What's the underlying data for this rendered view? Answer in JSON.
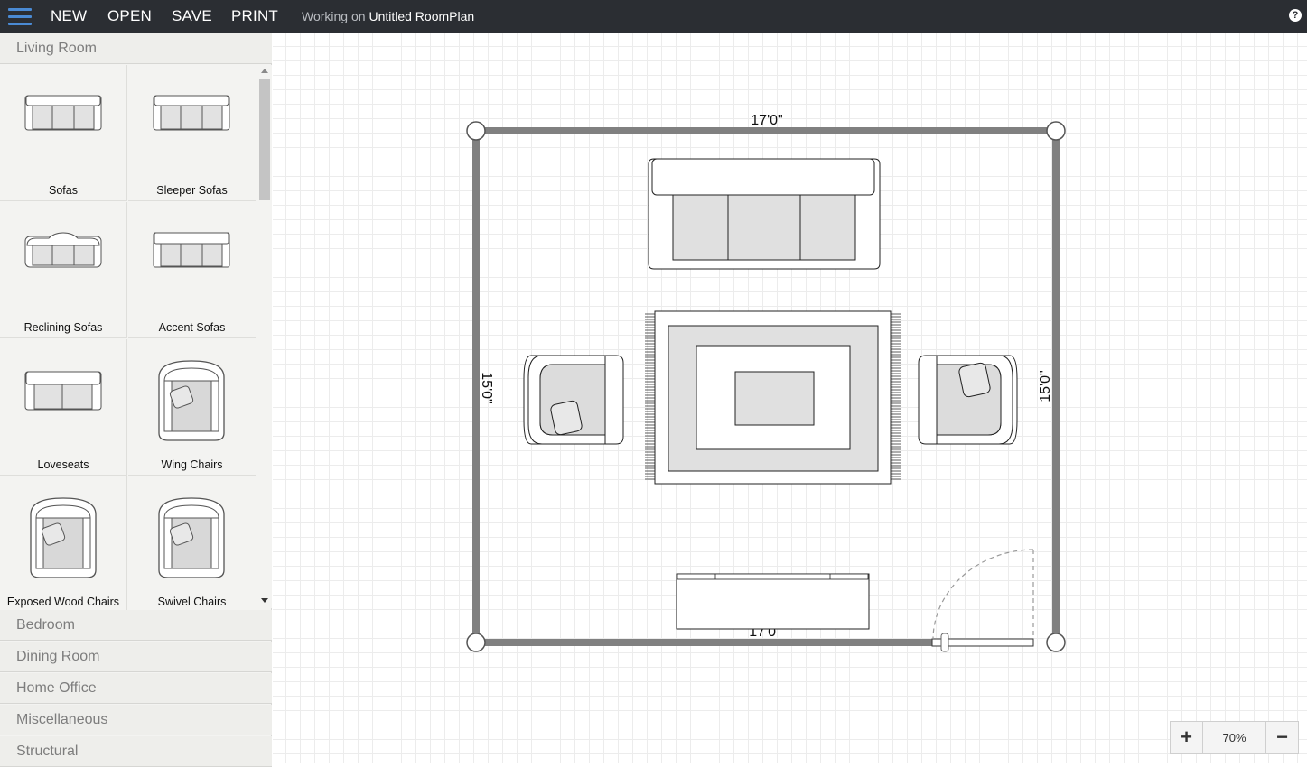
{
  "toolbar": {
    "new_label": "NEW",
    "open_label": "OPEN",
    "save_label": "SAVE",
    "print_label": "PRINT",
    "working_prefix": "Working on",
    "document_name": "Untitled RoomPlan",
    "help_label": "?"
  },
  "sidebar": {
    "active_category": "Living Room",
    "items": [
      {
        "label": "Sofas",
        "icon": "sofa-icon"
      },
      {
        "label": "Sleeper Sofas",
        "icon": "sleeper-sofa-icon"
      },
      {
        "label": "Reclining Sofas",
        "icon": "reclining-sofa-icon"
      },
      {
        "label": "Accent Sofas",
        "icon": "accent-sofa-icon"
      },
      {
        "label": "Loveseats",
        "icon": "loveseat-icon"
      },
      {
        "label": "Wing Chairs",
        "icon": "wing-chair-icon"
      },
      {
        "label": "Exposed Wood Chairs",
        "icon": "exposed-wood-chair-icon"
      },
      {
        "label": "Swivel Chairs",
        "icon": "swivel-chair-icon"
      }
    ],
    "categories": [
      "Bedroom",
      "Dining Room",
      "Home Office",
      "Miscellaneous",
      "Structural"
    ]
  },
  "plan": {
    "top_wall_length": "17'0\"",
    "bottom_wall_length": "17'0\"",
    "left_wall_length": "15'0\"",
    "right_wall_length": "15'0\""
  },
  "zoom": {
    "in_label": "+",
    "level": "70%",
    "out_label": "−"
  },
  "colors": {
    "topbar": "#2b2e33",
    "hamburger": "#4a8ad4",
    "wall": "#808080",
    "furniture_fill": "#e0e0e0"
  }
}
